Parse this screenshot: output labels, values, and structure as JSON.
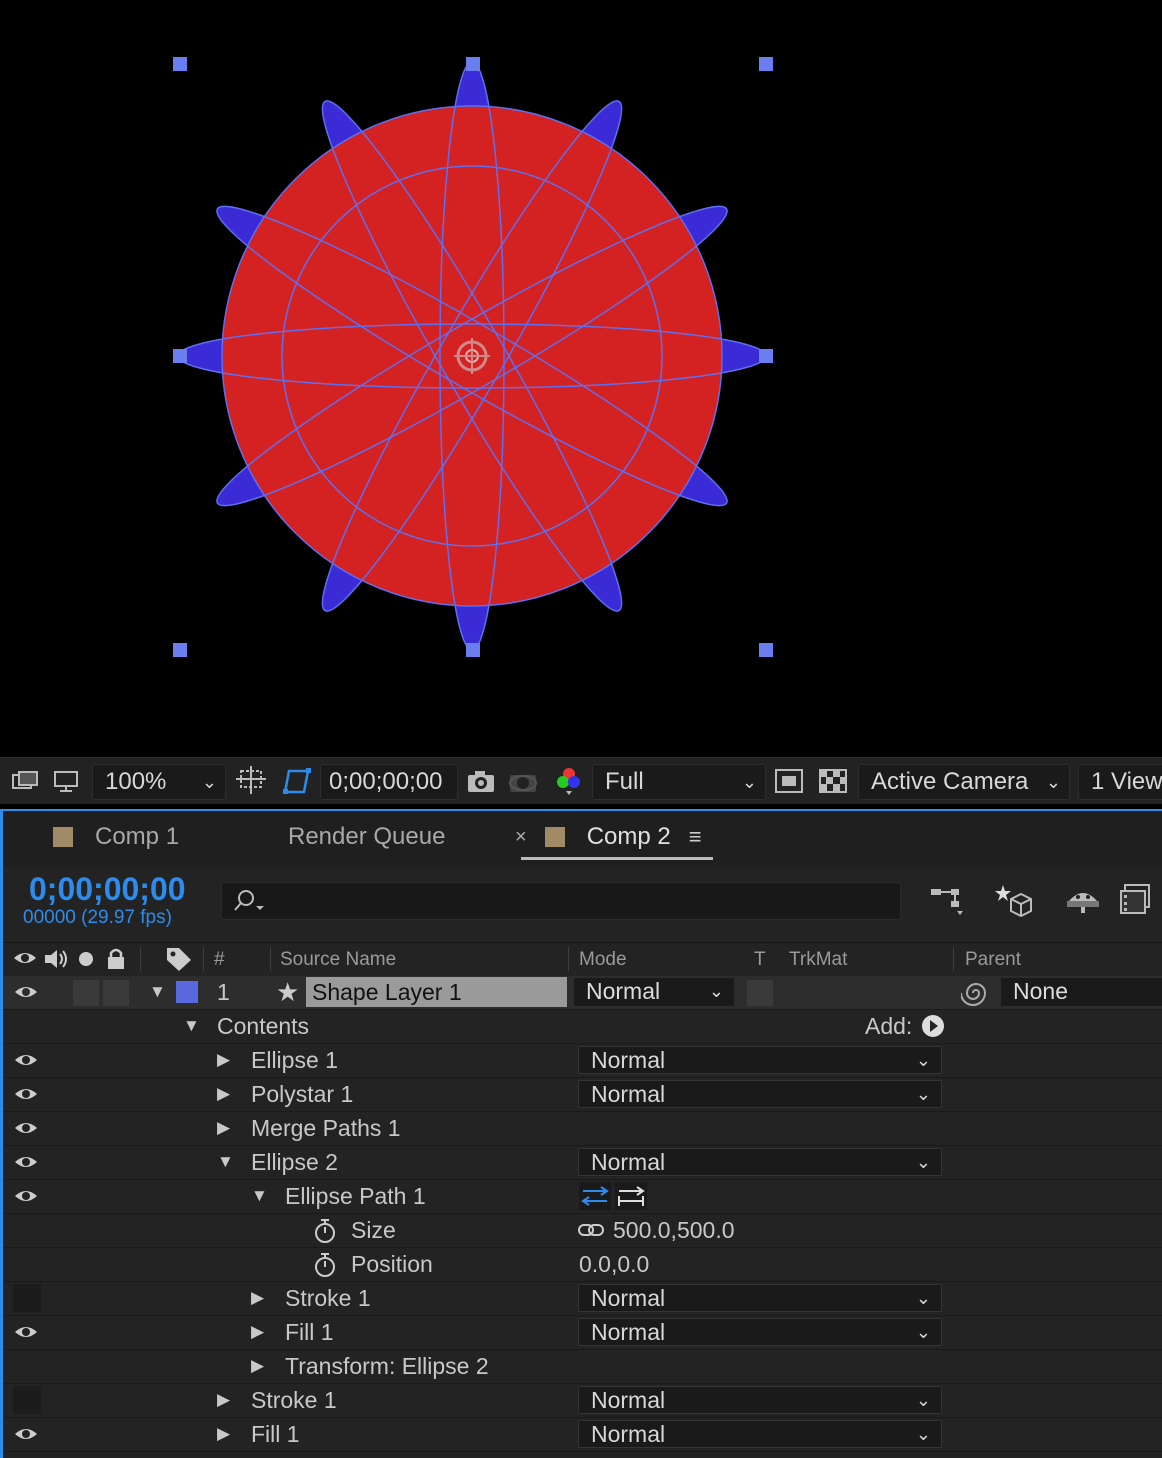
{
  "viewer_bar": {
    "zoom": "100%",
    "timecode": "0;00;00;00",
    "resolution": "Full",
    "camera": "Active Camera",
    "views": "1 View"
  },
  "tabs": [
    {
      "label": "Comp 1"
    },
    {
      "label": "Render Queue"
    },
    {
      "label": "Comp 2",
      "active": true
    }
  ],
  "timeline": {
    "timecode": "0;00;00;00",
    "frame_info": "00000 (29.97 fps)",
    "search_placeholder": ""
  },
  "columns": {
    "number": "#",
    "source_name": "Source Name",
    "mode": "Mode",
    "t": "T",
    "trkmat": "TrkMat",
    "parent": "Parent"
  },
  "layer": {
    "index": "1",
    "name": "Shape Layer 1",
    "mode": "Normal",
    "parent": "None"
  },
  "contents": {
    "label": "Contents",
    "add_label": "Add:"
  },
  "rows": [
    {
      "label": "Ellipse 1",
      "mode": "Normal",
      "eye": true,
      "expanded": false
    },
    {
      "label": "Polystar 1",
      "mode": "Normal",
      "eye": true,
      "expanded": false
    },
    {
      "label": "Merge Paths 1",
      "mode": "",
      "eye": true,
      "expanded": false
    },
    {
      "label": "Ellipse 2",
      "mode": "Normal",
      "eye": true,
      "expanded": true
    },
    {
      "label": "Ellipse Path 1",
      "mode": "",
      "eye": true,
      "expanded": true
    },
    {
      "label": "Size",
      "value": "500.0,500.0",
      "eye": false
    },
    {
      "label": "Position",
      "value": "0.0,0.0",
      "eye": false
    },
    {
      "label": "Stroke 1",
      "mode": "Normal",
      "eye": false,
      "expanded": false
    },
    {
      "label": "Fill 1",
      "mode": "Normal",
      "eye": true,
      "expanded": false
    },
    {
      "label": "Transform: Ellipse 2",
      "mode": "",
      "eye": false,
      "expanded": false
    },
    {
      "label": "Stroke 1",
      "mode": "Normal",
      "eye": false,
      "expanded": false
    },
    {
      "label": "Fill 1",
      "mode": "Normal",
      "eye": true,
      "expanded": false
    }
  ],
  "colors": {
    "accent": "#2d8ceb",
    "fill_red": "#d42121",
    "fill_blue": "#3b2bd6",
    "label_swatch": "#a18a66",
    "layer_color": "#5a68e0"
  }
}
